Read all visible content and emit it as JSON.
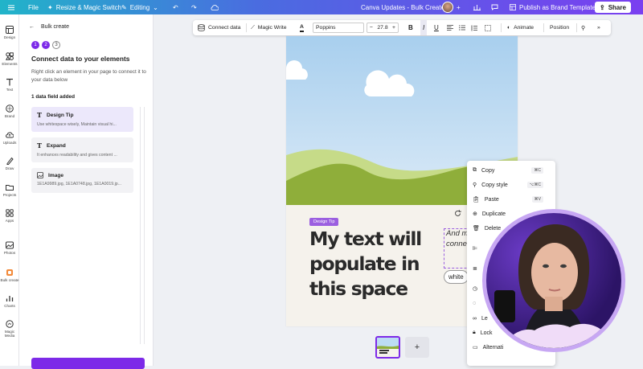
{
  "topbar": {
    "menu_icon": "hamburger-icon",
    "file": "File",
    "resize": "Resize & Magic Switch",
    "editing": "Editing",
    "title": "Canva Updates - Bulk Create",
    "publish": "Publish as Brand Template",
    "share": "Share"
  },
  "sidebar": {
    "items": [
      {
        "label": "Design",
        "icon": "design-icon"
      },
      {
        "label": "Elements",
        "icon": "elements-icon"
      },
      {
        "label": "Text",
        "icon": "text-icon"
      },
      {
        "label": "Brand",
        "icon": "brand-icon"
      },
      {
        "label": "Uploads",
        "icon": "uploads-icon"
      },
      {
        "label": "Draw",
        "icon": "draw-icon"
      },
      {
        "label": "Projects",
        "icon": "projects-icon"
      },
      {
        "label": "Apps",
        "icon": "apps-icon"
      },
      {
        "label": "Photos",
        "icon": "photos-icon"
      },
      {
        "label": "Bulk create",
        "icon": "bulk-create-icon"
      },
      {
        "label": "Charts",
        "icon": "charts-icon"
      },
      {
        "label": "Magic Media",
        "icon": "magic-media-icon"
      }
    ]
  },
  "panel": {
    "back": "Bulk create",
    "steps": [
      "1",
      "2",
      "3"
    ],
    "heading": "Connect data to your elements",
    "desc": "Right click an element in your page to connect it to your data below",
    "count": "1 data field added",
    "fields": [
      {
        "title": "Design Tip",
        "sub": "Use whitespace wisely, Maintain visual hi...",
        "icon": "text-icon"
      },
      {
        "title": "Expand",
        "sub": "It enhances readability and gives content ...",
        "icon": "text-icon"
      },
      {
        "title": "Image",
        "sub": "1E1A9989.jpg, 1E1A0748.jpg, 1E1A0019.jp...",
        "icon": "image-icon"
      }
    ]
  },
  "toolbar": {
    "connect": "Connect data",
    "magic_write": "Magic Write",
    "font": "Poppins",
    "size": "27.8",
    "animate": "Animate",
    "position": "Position"
  },
  "canvas": {
    "tag": "Design Tip",
    "headline": "My text will populate in this space",
    "side_text": "And m will ga I've se conne",
    "pill": "white"
  },
  "context_menu": {
    "items": [
      {
        "label": "Copy",
        "shortcut": "⌘C",
        "icon": "copy-icon"
      },
      {
        "label": "Copy style",
        "shortcut": "⌥⌘C",
        "icon": "paint-roller-icon"
      },
      {
        "label": "Paste",
        "shortcut": "⌘V",
        "icon": "clipboard-icon"
      },
      {
        "label": "Duplicate",
        "shortcut": "",
        "icon": "duplicate-icon"
      },
      {
        "label": "Delete",
        "shortcut": "",
        "icon": "trash-icon"
      },
      {
        "label": "Le",
        "shortcut": "",
        "icon": "link-icon"
      },
      {
        "label": "Lock",
        "shortcut": "",
        "icon": "lock-icon"
      },
      {
        "label": "Alternati",
        "shortcut": "",
        "icon": "alt-text-icon"
      }
    ]
  },
  "pages": {
    "add": "+"
  },
  "colors": {
    "accent": "#7d2ae8",
    "tag": "#9b5fe0"
  }
}
